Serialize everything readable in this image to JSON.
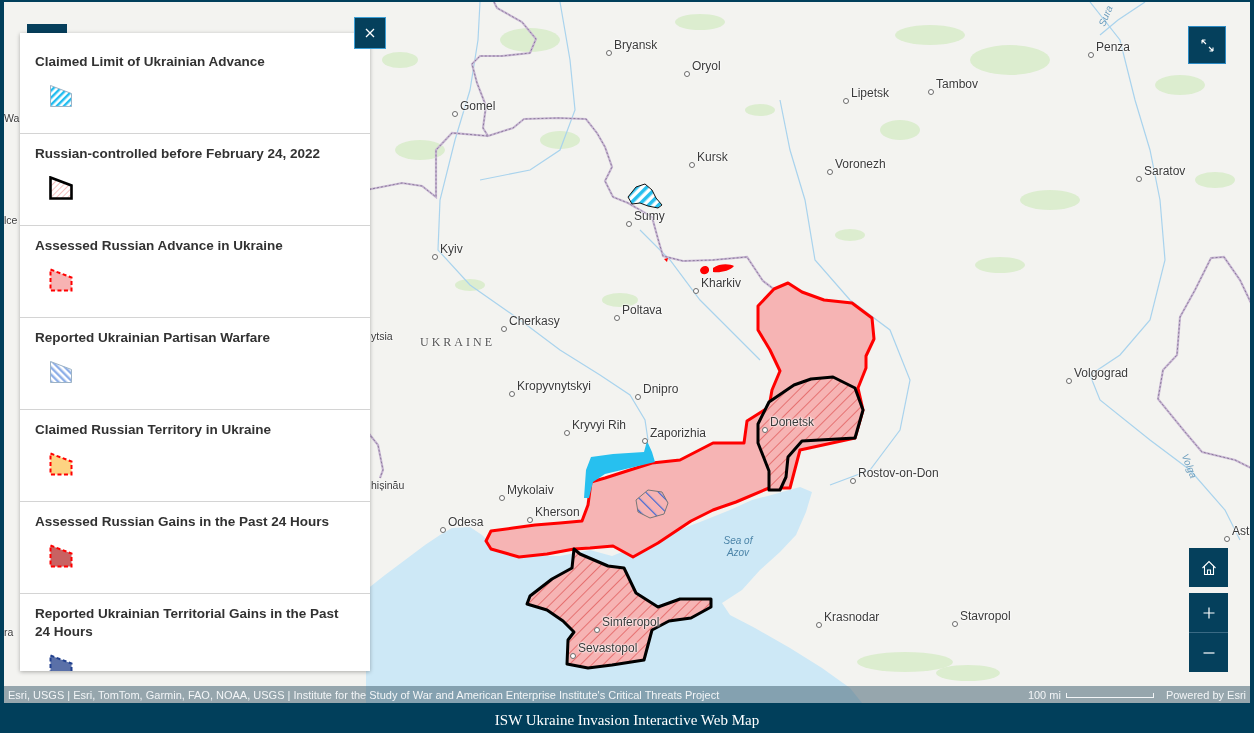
{
  "legend": {
    "items": [
      {
        "title": "Claimed Limit of Ukrainian Advance",
        "kind": "hatch",
        "color": "#22bdf0"
      },
      {
        "title": "Russian-controlled before February 24, 2022",
        "kind": "outline",
        "color": "#000000"
      },
      {
        "title": "Assessed Russian Advance in Ukraine",
        "kind": "dashed",
        "color": "#f7b3b3"
      },
      {
        "title": "Reported Ukrainian Partisan Warfare",
        "kind": "backhatch",
        "color": "#8fb0e8"
      },
      {
        "title": "Claimed Russian Territory in Ukraine",
        "kind": "dashed",
        "color": "#fdd382"
      },
      {
        "title": "Assessed Russian Gains in the Past 24 Hours",
        "kind": "dashed",
        "color": "#c86262"
      },
      {
        "title": "Reported Ukrainian Territorial Gains in the Past 24 Hours",
        "kind": "dark-dashed",
        "color": "#5a70a8"
      }
    ]
  },
  "map": {
    "places": [
      {
        "name": "Sura",
        "kind": "river"
      },
      {
        "name": "Bryansk",
        "kind": "city"
      },
      {
        "name": "Penza",
        "kind": "city"
      },
      {
        "name": "Oryol",
        "kind": "city"
      },
      {
        "name": "Tambov",
        "kind": "city"
      },
      {
        "name": "Lipetsk",
        "kind": "city"
      },
      {
        "name": "Gomel",
        "kind": "city"
      },
      {
        "name": "Wa",
        "kind": "label"
      },
      {
        "name": "Kursk",
        "kind": "city"
      },
      {
        "name": "Voronezh",
        "kind": "city"
      },
      {
        "name": "Saratov",
        "kind": "city"
      },
      {
        "name": "Sumy",
        "kind": "city"
      },
      {
        "name": "lce",
        "kind": "label"
      },
      {
        "name": "Kyiv",
        "kind": "city"
      },
      {
        "name": "Kharkiv",
        "kind": "city"
      },
      {
        "name": "Poltava",
        "kind": "city"
      },
      {
        "name": "Cherkasy",
        "kind": "city"
      },
      {
        "name": "ytsia",
        "kind": "label"
      },
      {
        "name": "UKRAINE",
        "kind": "country"
      },
      {
        "name": "Volgograd",
        "kind": "city"
      },
      {
        "name": "Kropyvnytskyi",
        "kind": "city"
      },
      {
        "name": "Dnipro",
        "kind": "city"
      },
      {
        "name": "Donetsk",
        "kind": "city"
      },
      {
        "name": "Kryvyi Rih",
        "kind": "city"
      },
      {
        "name": "Zaporizhia",
        "kind": "city"
      },
      {
        "name": "Volga",
        "kind": "river"
      },
      {
        "name": "Rostov-on-Don",
        "kind": "city"
      },
      {
        "name": "hișinău",
        "kind": "label"
      },
      {
        "name": "Mykolaiv",
        "kind": "city"
      },
      {
        "name": "Kherson",
        "kind": "city"
      },
      {
        "name": "Odesa",
        "kind": "city"
      },
      {
        "name": "Ast",
        "kind": "city"
      },
      {
        "name": "Sea of Azov",
        "kind": "water"
      },
      {
        "name": "Stavropol",
        "kind": "city"
      },
      {
        "name": "Krasnodar",
        "kind": "city"
      },
      {
        "name": "Simferopol",
        "kind": "city"
      },
      {
        "name": "ra",
        "kind": "label"
      },
      {
        "name": "Sevastopol",
        "kind": "city"
      }
    ]
  },
  "attribution": {
    "sources": "Esri, USGS | Esri, TomTom, Garmin, FAO, NOAA, USGS | Institute for the Study of War and American Enterprise Institute's Critical Threats Project",
    "scale": "100 mi",
    "powered_by": "Powered by Esri"
  },
  "footer": {
    "title": "ISW Ukraine Invasion Interactive Web Map"
  }
}
